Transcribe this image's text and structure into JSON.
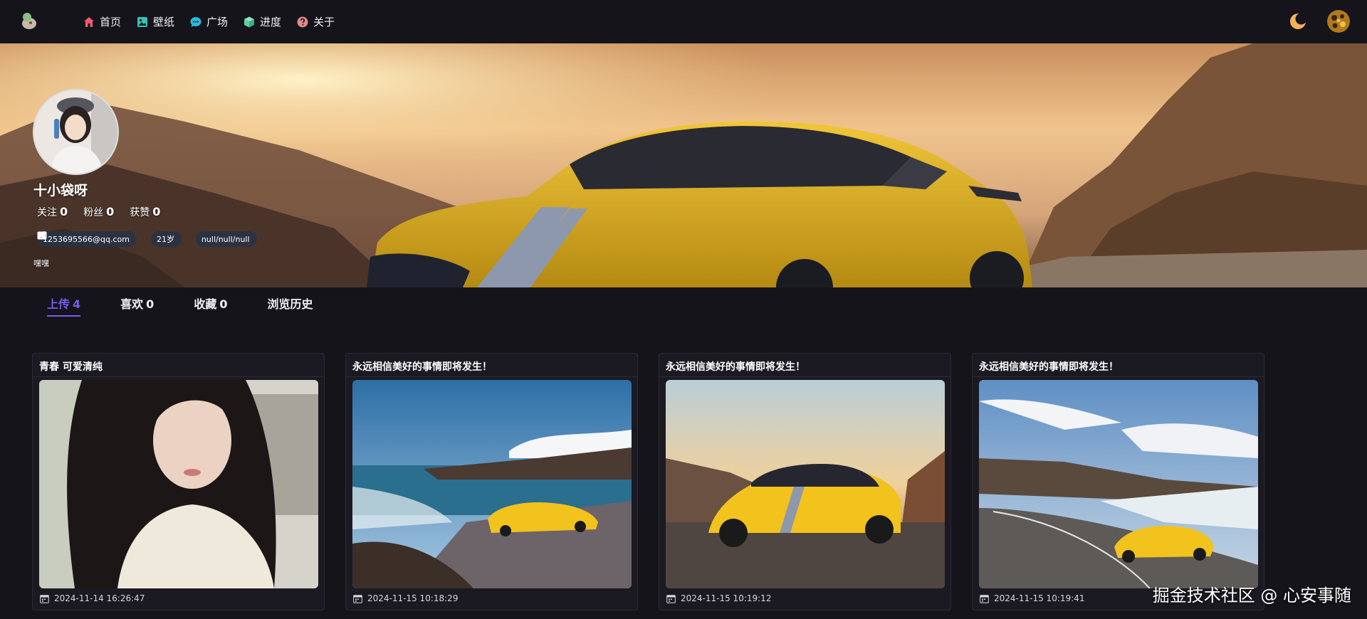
{
  "nav": {
    "items": [
      {
        "label": "首页",
        "icon": "home-icon",
        "color": "#ef5b6c"
      },
      {
        "label": "壁纸",
        "icon": "image-icon",
        "color": "#35c4b5"
      },
      {
        "label": "广场",
        "icon": "chat-icon",
        "color": "#2fb8d9"
      },
      {
        "label": "进度",
        "icon": "cube-icon",
        "color": "#5fcfa2"
      },
      {
        "label": "关于",
        "icon": "question-icon",
        "color": "#e08a8a"
      }
    ]
  },
  "profile": {
    "name": "十小袋呀",
    "stats": [
      {
        "label": "关注",
        "value": "0"
      },
      {
        "label": "粉丝",
        "value": "0"
      },
      {
        "label": "获赞",
        "value": "0"
      }
    ],
    "email": "1253695566@qq.com",
    "age": "21岁",
    "location": "null/null/null",
    "bio": "嘿嘿"
  },
  "tabs": [
    {
      "label": "上传",
      "count": "4"
    },
    {
      "label": "喜欢",
      "count": "0"
    },
    {
      "label": "收藏",
      "count": "0"
    },
    {
      "label": "浏览历史",
      "count": ""
    }
  ],
  "cards": [
    {
      "title": "青春 可爱清纯",
      "date": "2024-11-14 16:26:47"
    },
    {
      "title": "永远相信美好的事情即将发生！",
      "date": "2024-11-15 10:18:29"
    },
    {
      "title": "永远相信美好的事情即将发生！",
      "date": "2024-11-15 10:19:12"
    },
    {
      "title": "永远相信美好的事情即将发生！",
      "date": "2024-11-15 10:19:41"
    }
  ],
  "watermark": "掘金技术社区 @ 心安事随",
  "colors": {
    "accent": "#7a5cf0",
    "background": "#15141b",
    "card": "#1b1a22"
  }
}
